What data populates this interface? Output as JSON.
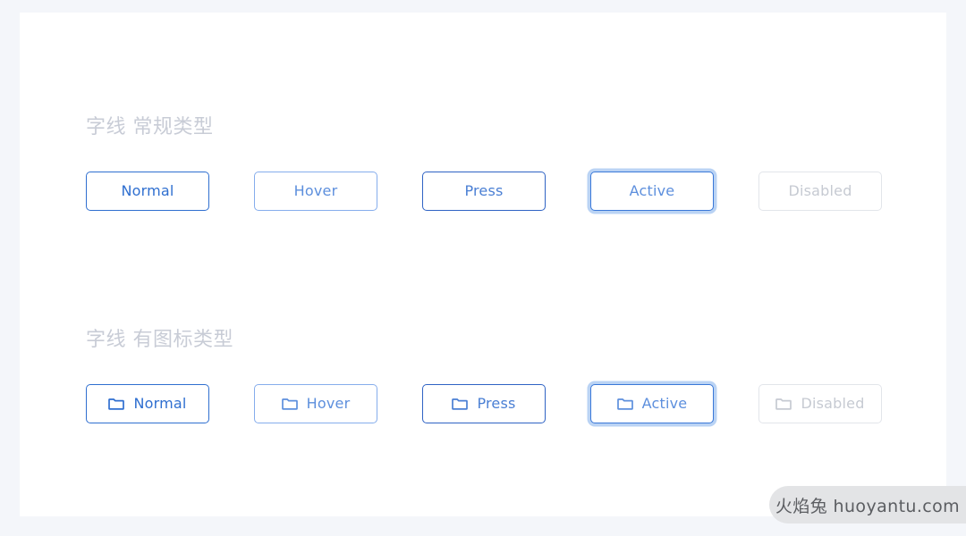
{
  "theme": {
    "page_background": "#f4f6fa",
    "card_background": "#ffffff",
    "accent_blue": "#2f6fd0",
    "hover_blue": "#86adec",
    "active_glow": "#82aeeb",
    "disabled_border": "#e2e5ea",
    "disabled_text": "#c6cad2",
    "heading_color": "#c8ccd6"
  },
  "sections": [
    {
      "title": "字线 常规类型",
      "buttons": [
        {
          "label": "Normal",
          "state": "normal",
          "icon": null
        },
        {
          "label": "Hover",
          "state": "hover",
          "icon": null
        },
        {
          "label": "Press",
          "state": "press",
          "icon": null
        },
        {
          "label": "Active",
          "state": "active",
          "icon": null
        },
        {
          "label": "Disabled",
          "state": "disabled",
          "icon": null
        }
      ]
    },
    {
      "title": "字线 有图标类型",
      "buttons": [
        {
          "label": "Normal",
          "state": "normal",
          "icon": "folder-icon"
        },
        {
          "label": "Hover",
          "state": "hover",
          "icon": "folder-icon"
        },
        {
          "label": "Press",
          "state": "press",
          "icon": "folder-icon"
        },
        {
          "label": "Active",
          "state": "active",
          "icon": "folder-icon"
        },
        {
          "label": "Disabled",
          "state": "disabled",
          "icon": "folder-icon"
        }
      ]
    }
  ],
  "watermark": {
    "text": "火焰兔 huoyantu.com"
  }
}
